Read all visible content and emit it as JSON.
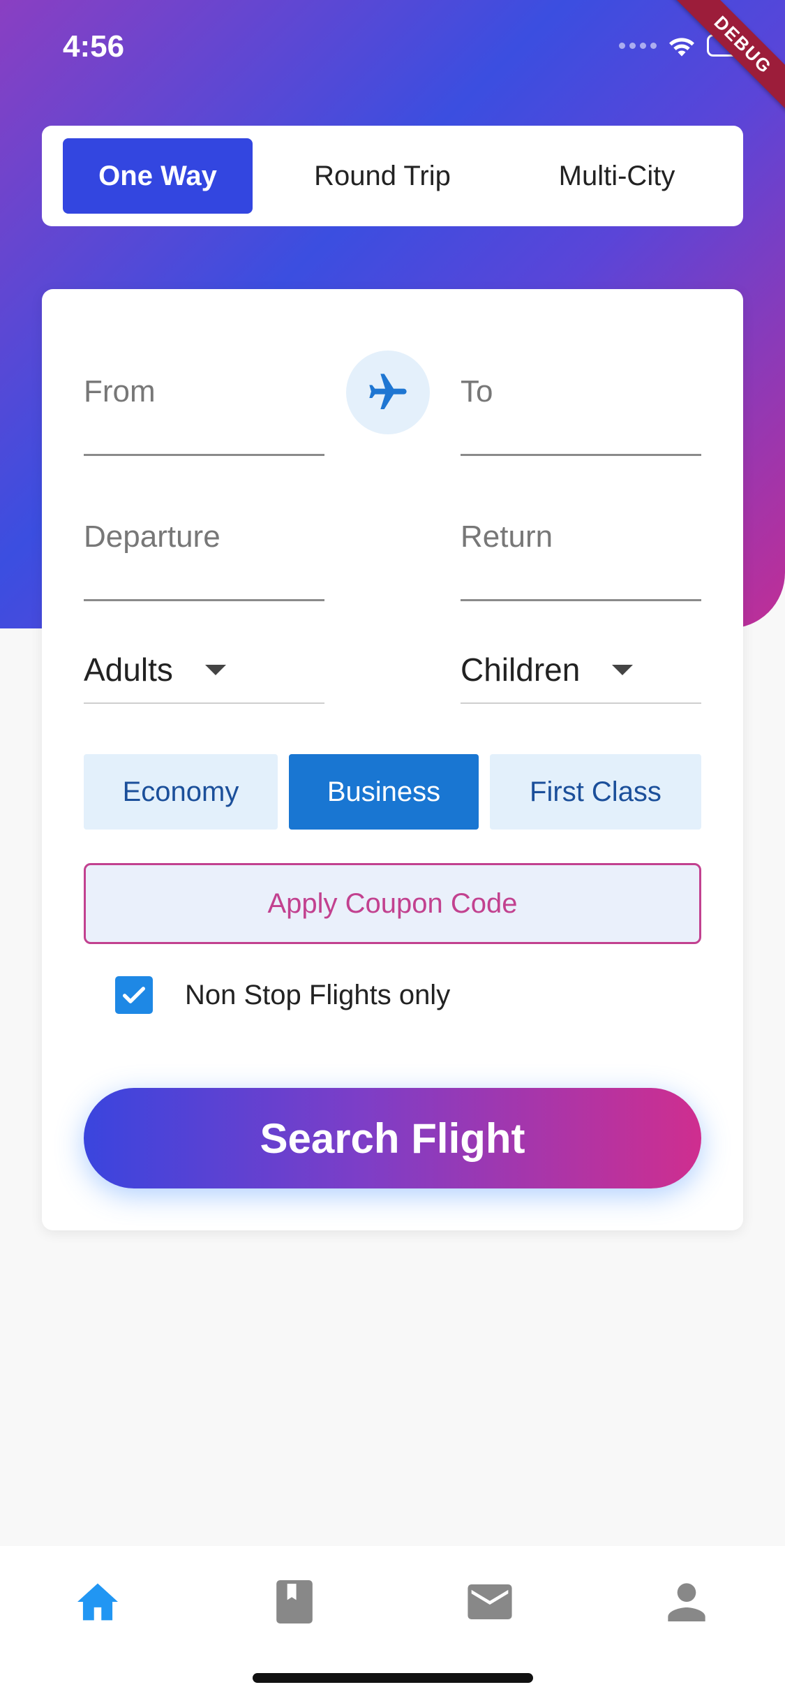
{
  "status_bar": {
    "time": "4:56",
    "debug_label": "DEBUG"
  },
  "trip_types": {
    "items": [
      {
        "label": "One Way",
        "active": true
      },
      {
        "label": "Round Trip",
        "active": false
      },
      {
        "label": "Multi-City",
        "active": false
      }
    ]
  },
  "form": {
    "from_placeholder": "From",
    "to_placeholder": "To",
    "departure_placeholder": "Departure",
    "return_placeholder": "Return",
    "adults_label": "Adults",
    "children_label": "Children",
    "classes": [
      {
        "label": "Economy",
        "active": false
      },
      {
        "label": "Business",
        "active": true
      },
      {
        "label": "First Class",
        "active": false
      }
    ],
    "coupon_label": "Apply Coupon Code",
    "nonstop_label": "Non Stop Flights only",
    "nonstop_checked": true,
    "search_label": "Search Flight"
  },
  "bottom_nav": {
    "items": [
      {
        "icon": "home-icon",
        "active": true
      },
      {
        "icon": "book-icon",
        "active": false
      },
      {
        "icon": "mail-icon",
        "active": false
      },
      {
        "icon": "person-icon",
        "active": false
      }
    ]
  },
  "colors": {
    "primary": "#3346e0",
    "accent_blue": "#1976d2",
    "coupon": "#c2418f",
    "gradient_start": "#3a45de",
    "gradient_end": "#cf2e8f"
  }
}
